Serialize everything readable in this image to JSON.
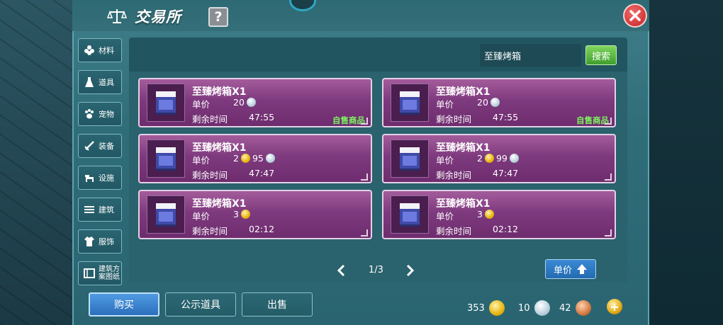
{
  "title": "交易所",
  "help_label": "?",
  "sidebar": {
    "items": [
      {
        "label": "材料",
        "icon": "flower-icon"
      },
      {
        "label": "道具",
        "icon": "flask-icon"
      },
      {
        "label": "宠物",
        "icon": "paw-icon"
      },
      {
        "label": "装备",
        "icon": "sword-icon"
      },
      {
        "label": "设施",
        "icon": "horse-icon"
      },
      {
        "label": "建筑",
        "icon": "building-icon"
      },
      {
        "label": "服饰",
        "icon": "clothing-icon"
      },
      {
        "label": "建筑方案图纸",
        "icon": "blueprint-icon"
      }
    ]
  },
  "search": {
    "value": "至臻烤箱",
    "button_label": "搜索"
  },
  "listings": [
    {
      "name": "至臻烤箱X1",
      "price_label": "单价",
      "price_gold": "",
      "price_silver": "20",
      "time_label": "剩余时间",
      "time": "47:55",
      "self_sale": "自售商品"
    },
    {
      "name": "至臻烤箱X1",
      "price_label": "单价",
      "price_gold": "",
      "price_silver": "20",
      "time_label": "剩余时间",
      "time": "47:55",
      "self_sale": "自售商品"
    },
    {
      "name": "至臻烤箱X1",
      "price_label": "单价",
      "price_gold": "2",
      "price_silver": "95",
      "time_label": "剩余时间",
      "time": "47:47",
      "self_sale": ""
    },
    {
      "name": "至臻烤箱X1",
      "price_label": "单价",
      "price_gold": "2",
      "price_silver": "99",
      "time_label": "剩余时间",
      "time": "47:47",
      "self_sale": ""
    },
    {
      "name": "至臻烤箱X1",
      "price_label": "单价",
      "price_gold": "3",
      "price_silver": "",
      "time_label": "剩余时间",
      "time": "02:12",
      "self_sale": ""
    },
    {
      "name": "至臻烤箱X1",
      "price_label": "单价",
      "price_gold": "3",
      "price_silver": "",
      "time_label": "剩余时间",
      "time": "02:12",
      "self_sale": ""
    }
  ],
  "pager": {
    "text": "1/3"
  },
  "sort": {
    "label": "单价"
  },
  "bottom": {
    "buy": "购买",
    "public": "公示道具",
    "sell": "出售"
  },
  "currency": {
    "gold": "353",
    "silver": "10",
    "copper": "42"
  },
  "colors": {
    "card": "#7e3a7e",
    "self_sale": "#7cf55f",
    "search_btn": "#4fae3a",
    "buy_btn": "#2c6fbc"
  }
}
